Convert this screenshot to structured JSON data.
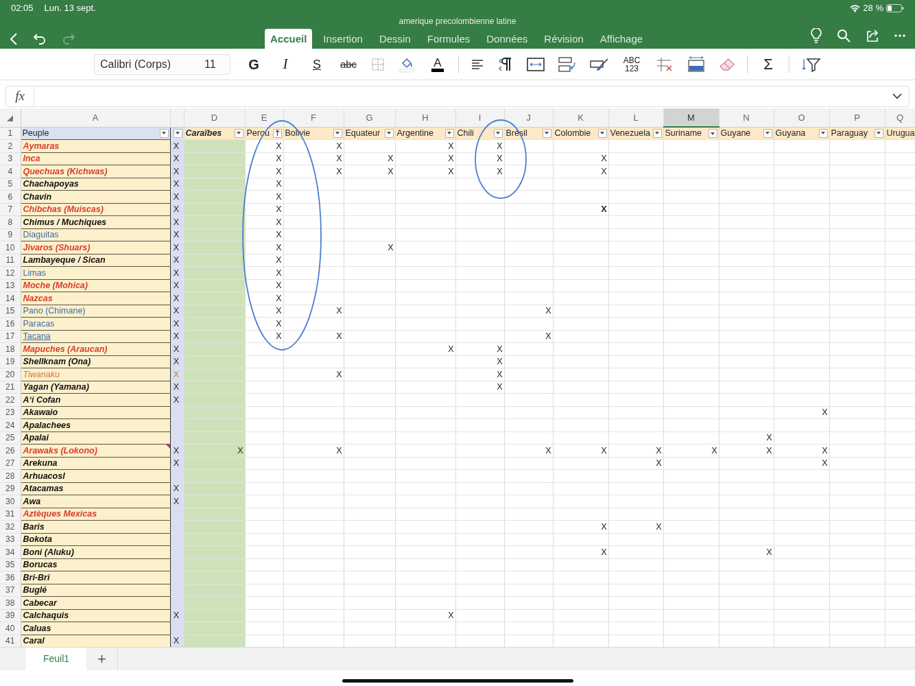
{
  "status_bar": {
    "time": "02:05",
    "date": "Lun. 13 sept.",
    "battery": "28 %"
  },
  "document_title": "amerique precolombienne latine",
  "nav": {
    "redo_disabled": true
  },
  "tabs": [
    {
      "label": "Accueil",
      "selected": true
    },
    {
      "label": "Insertion",
      "selected": false
    },
    {
      "label": "Dessin",
      "selected": false
    },
    {
      "label": "Formules",
      "selected": false
    },
    {
      "label": "Données",
      "selected": false
    },
    {
      "label": "Révision",
      "selected": false
    },
    {
      "label": "Affichage",
      "selected": false
    }
  ],
  "ribbon": {
    "font_name": "Calibri (Corps)",
    "font_size": "11",
    "groups": [
      [
        {
          "kind": "bold",
          "label": "G"
        },
        {
          "kind": "italic",
          "label": "I"
        },
        {
          "kind": "underline",
          "label": "S"
        },
        {
          "kind": "strikethrough",
          "label": "abc"
        },
        {
          "kind": "borders"
        },
        {
          "kind": "fill"
        },
        {
          "kind": "font-color",
          "label": "A"
        }
      ],
      [
        {
          "kind": "align"
        },
        {
          "kind": "paragraph"
        },
        {
          "kind": "wrap"
        },
        {
          "kind": "merge"
        },
        {
          "kind": "painter"
        },
        {
          "kind": "number-format",
          "label": "ABC",
          "sublabel": "123"
        },
        {
          "kind": "insert-delete"
        },
        {
          "kind": "cell-size"
        },
        {
          "kind": "clear"
        }
      ],
      [
        {
          "kind": "autosum",
          "label": "Σ"
        }
      ],
      [
        {
          "kind": "sort-filter"
        }
      ]
    ]
  },
  "formula_bar": {
    "label": "fx"
  },
  "sheet": {
    "columns": [
      {
        "letter": "A",
        "header": "Peuple",
        "kind": "plain",
        "filter": true,
        "sorted": false,
        "selected": false
      },
      {
        "kind": "plain",
        "filter": true,
        "sorted": false,
        "selected": false
      },
      {
        "letter": "D",
        "header": "Caraïbes",
        "kind": "emphasis",
        "filter": true,
        "sorted": false,
        "selected": false
      },
      {
        "letter": "E",
        "header": "Perou",
        "kind": "plain",
        "filter": true,
        "sorted": true,
        "selected": false
      },
      {
        "letter": "F",
        "header": "Bolivie",
        "kind": "plain",
        "filter": true,
        "sorted": false,
        "selected": false
      },
      {
        "letter": "G",
        "header": "Equateur",
        "kind": "plain",
        "filter": true,
        "sorted": false,
        "selected": false
      },
      {
        "letter": "H",
        "header": "Argentine",
        "kind": "plain",
        "filter": true,
        "sorted": false,
        "selected": false
      },
      {
        "letter": "I",
        "header": "Chili",
        "kind": "plain",
        "filter": true,
        "sorted": false,
        "selected": false
      },
      {
        "letter": "J",
        "header": "Brésil",
        "kind": "plain",
        "filter": true,
        "sorted": false,
        "selected": false
      },
      {
        "letter": "K",
        "header": "Colombie",
        "kind": "plain",
        "filter": true,
        "sorted": false,
        "selected": false
      },
      {
        "letter": "L",
        "header": "Venezuela",
        "kind": "plain",
        "filter": true,
        "sorted": false,
        "selected": false
      },
      {
        "letter": "M",
        "header": "Suriname",
        "kind": "plain",
        "filter": true,
        "sorted": false,
        "selected": true
      },
      {
        "letter": "N",
        "header": "Guyane",
        "kind": "plain",
        "filter": true,
        "sorted": false,
        "selected": false
      },
      {
        "letter": "O",
        "header": "Guyana",
        "kind": "plain",
        "filter": true,
        "sorted": false,
        "selected": false
      },
      {
        "letter": "P",
        "header": "Paraguay",
        "kind": "plain",
        "filter": true,
        "sorted": false,
        "selected": false
      },
      {
        "letter": "Q",
        "header": "Urugua",
        "kind": "plain",
        "selected": false
      }
    ],
    "header_row_number": "1",
    "rows": [
      {
        "number": "2",
        "kind": "red",
        "cells": [
          "Aymaras",
          "X",
          null,
          "X",
          "X",
          null,
          "X",
          "X",
          null,
          null,
          null,
          null,
          null,
          null,
          null,
          null
        ]
      },
      {
        "number": "3",
        "kind": "red",
        "cells": [
          "Inca",
          "X",
          null,
          "X",
          "X",
          "X",
          "X",
          "X",
          null,
          "X",
          null,
          null,
          null,
          null,
          null,
          null
        ]
      },
      {
        "number": "4",
        "kind": "red",
        "cells": [
          "Quechuas (Kichwas)",
          "X",
          null,
          "X",
          "X",
          "X",
          "X",
          "X",
          null,
          "X",
          null,
          null,
          null,
          null,
          null,
          null
        ]
      },
      {
        "number": "5",
        "kind": "black",
        "cells": [
          "Chachapoyas",
          "X",
          null,
          "X",
          null,
          null,
          null,
          null,
          null,
          null,
          null,
          null,
          null,
          null,
          null,
          null
        ]
      },
      {
        "number": "6",
        "kind": "black",
        "cells": [
          "Chavin",
          "X",
          null,
          "X",
          null,
          null,
          null,
          null,
          null,
          null,
          null,
          null,
          null,
          null,
          null,
          null
        ]
      },
      {
        "number": "7",
        "kind": "red",
        "cells": [
          "Chibchas (Muiscas)",
          "X",
          null,
          "X",
          null,
          null,
          null,
          null,
          null,
          "**X**",
          null,
          null,
          null,
          null,
          null,
          null
        ]
      },
      {
        "number": "8",
        "kind": "black",
        "cells": [
          "Chimus / Muchiques",
          "X",
          null,
          "X",
          null,
          null,
          null,
          null,
          null,
          null,
          null,
          null,
          null,
          null,
          null,
          null
        ]
      },
      {
        "number": "9",
        "kind": "blue",
        "cells": [
          "Diaguitas",
          "X",
          null,
          "X",
          null,
          null,
          null,
          null,
          null,
          null,
          null,
          null,
          null,
          null,
          null,
          null
        ]
      },
      {
        "number": "10",
        "kind": "red",
        "cells": [
          "Jivaros (Shuars)",
          "X",
          null,
          "X",
          null,
          "X",
          null,
          null,
          null,
          null,
          null,
          null,
          null,
          null,
          null,
          null
        ]
      },
      {
        "number": "11",
        "kind": "black",
        "cells": [
          "Lambayeque / Sican",
          "X",
          null,
          "X",
          null,
          null,
          null,
          null,
          null,
          null,
          null,
          null,
          null,
          null,
          null,
          null
        ]
      },
      {
        "number": "12",
        "kind": "blue",
        "cells": [
          "Limas",
          "X",
          null,
          "X",
          null,
          null,
          null,
          null,
          null,
          null,
          null,
          null,
          null,
          null,
          null,
          null
        ]
      },
      {
        "number": "13",
        "kind": "red",
        "cells": [
          "Moche (Mohica)",
          "X",
          null,
          "X",
          null,
          null,
          null,
          null,
          null,
          null,
          null,
          null,
          null,
          null,
          null,
          null
        ]
      },
      {
        "number": "14",
        "kind": "red",
        "cells": [
          "Nazcas",
          "X",
          null,
          "X",
          null,
          null,
          null,
          null,
          null,
          null,
          null,
          null,
          null,
          null,
          null,
          null
        ]
      },
      {
        "number": "15",
        "kind": "blue",
        "cells": [
          "Pano (Chimane)",
          "X",
          null,
          "X",
          "X",
          null,
          null,
          null,
          "X",
          null,
          null,
          null,
          null,
          null,
          null,
          null
        ]
      },
      {
        "number": "16",
        "kind": "blue",
        "cells": [
          "Paracas",
          "X",
          null,
          "X",
          null,
          null,
          null,
          null,
          null,
          null,
          null,
          null,
          null,
          null,
          null,
          null
        ]
      },
      {
        "number": "17",
        "kind": "link",
        "cells": [
          "Tacana",
          "X",
          null,
          "X",
          "X",
          null,
          null,
          null,
          "X",
          null,
          null,
          null,
          null,
          null,
          null,
          null
        ]
      },
      {
        "number": "18",
        "kind": "red",
        "cells": [
          "Mapuches (Araucan)",
          "X",
          null,
          null,
          null,
          null,
          "X",
          "X",
          null,
          null,
          null,
          null,
          null,
          null,
          null,
          null
        ]
      },
      {
        "number": "19",
        "kind": "black",
        "cells": [
          "Shellknam (Ona)",
          "X",
          null,
          null,
          null,
          null,
          null,
          "X",
          null,
          null,
          null,
          null,
          null,
          null,
          null,
          null
        ]
      },
      {
        "number": "20",
        "kind": "orange",
        "cells": [
          "Tiwanaku",
          "X",
          null,
          null,
          "X",
          null,
          null,
          "X",
          null,
          null,
          null,
          null,
          null,
          null,
          null,
          null
        ]
      },
      {
        "number": "21",
        "kind": "black",
        "cells": [
          "Yagan (Yamana)",
          "X",
          null,
          null,
          null,
          null,
          null,
          "X",
          null,
          null,
          null,
          null,
          null,
          null,
          null,
          null
        ]
      },
      {
        "number": "22",
        "kind": "black",
        "cells": [
          "A‘i Cofan",
          "X",
          null,
          null,
          null,
          null,
          null,
          null,
          null,
          null,
          null,
          null,
          null,
          null,
          null,
          null
        ]
      },
      {
        "number": "23",
        "kind": "black",
        "cells": [
          "Akawaio",
          null,
          null,
          null,
          null,
          null,
          null,
          null,
          null,
          null,
          null,
          null,
          null,
          "X",
          null,
          null
        ]
      },
      {
        "number": "24",
        "kind": "black",
        "cells": [
          "Apalachees",
          null,
          null,
          null,
          null,
          null,
          null,
          null,
          null,
          null,
          null,
          null,
          null,
          null,
          null,
          null
        ]
      },
      {
        "number": "25",
        "kind": "black",
        "cells": [
          "Apalai",
          null,
          null,
          null,
          null,
          null,
          null,
          null,
          null,
          null,
          null,
          null,
          "X",
          null,
          null,
          null
        ]
      },
      {
        "number": "26",
        "kind": "red",
        "comment": true,
        "cells": [
          "Arawaks (Lokono)",
          "X",
          "X",
          null,
          "X",
          null,
          null,
          null,
          "X",
          "X",
          "X",
          "X",
          "X",
          "X",
          null,
          null
        ]
      },
      {
        "number": "27",
        "kind": "black",
        "cells": [
          "Arekuna",
          "X",
          null,
          null,
          null,
          null,
          null,
          null,
          null,
          null,
          "X",
          null,
          null,
          "X",
          null,
          null
        ]
      },
      {
        "number": "28",
        "kind": "black",
        "cells": [
          "Arhuacosl",
          null,
          null,
          null,
          null,
          null,
          null,
          null,
          null,
          null,
          null,
          null,
          null,
          null,
          null,
          null
        ]
      },
      {
        "number": "29",
        "kind": "black",
        "cells": [
          "Atacamas",
          "X",
          null,
          null,
          null,
          null,
          null,
          null,
          null,
          null,
          null,
          null,
          null,
          null,
          null,
          null
        ]
      },
      {
        "number": "30",
        "kind": "black",
        "cells": [
          "Awa",
          "X",
          null,
          null,
          null,
          null,
          null,
          null,
          null,
          null,
          null,
          null,
          null,
          null,
          null,
          null
        ]
      },
      {
        "number": "31",
        "kind": "red",
        "cells": [
          "Aztèques Mexicas",
          null,
          null,
          null,
          null,
          null,
          null,
          null,
          null,
          null,
          null,
          null,
          null,
          null,
          null,
          null
        ]
      },
      {
        "number": "32",
        "kind": "black",
        "cells": [
          "Baris",
          null,
          null,
          null,
          null,
          null,
          null,
          null,
          null,
          "X",
          "X",
          null,
          null,
          null,
          null,
          null
        ]
      },
      {
        "number": "33",
        "kind": "black",
        "cells": [
          "Bokota",
          null,
          null,
          null,
          null,
          null,
          null,
          null,
          null,
          null,
          null,
          null,
          null,
          null,
          null,
          null
        ]
      },
      {
        "number": "34",
        "kind": "black",
        "cells": [
          "Boni (Aluku)",
          null,
          null,
          null,
          null,
          null,
          null,
          null,
          null,
          "X",
          null,
          null,
          "X",
          null,
          null,
          null
        ]
      },
      {
        "number": "35",
        "kind": "black",
        "cells": [
          "Borucas",
          null,
          null,
          null,
          null,
          null,
          null,
          null,
          null,
          null,
          null,
          null,
          null,
          null,
          null,
          null
        ]
      },
      {
        "number": "36",
        "kind": "black",
        "cells": [
          "Bri-Bri",
          null,
          null,
          null,
          null,
          null,
          null,
          null,
          null,
          null,
          null,
          null,
          null,
          null,
          null,
          null
        ]
      },
      {
        "number": "37",
        "kind": "black",
        "cells": [
          "Buglé",
          null,
          null,
          null,
          null,
          null,
          null,
          null,
          null,
          null,
          null,
          null,
          null,
          null,
          null,
          null
        ]
      },
      {
        "number": "38",
        "kind": "black",
        "cells": [
          "Cabecar",
          null,
          null,
          null,
          null,
          null,
          null,
          null,
          null,
          null,
          null,
          null,
          null,
          null,
          null,
          null
        ]
      },
      {
        "number": "39",
        "kind": "black",
        "cells": [
          "Calchaquis",
          "X",
          null,
          null,
          null,
          null,
          "X",
          null,
          null,
          null,
          null,
          null,
          null,
          null,
          null,
          null
        ]
      },
      {
        "number": "40",
        "kind": "black",
        "cells": [
          "Caluas",
          null,
          null,
          null,
          null,
          null,
          null,
          null,
          null,
          null,
          null,
          null,
          null,
          null,
          null,
          null
        ]
      },
      {
        "number": "41",
        "kind": "black",
        "cells": [
          "Caral",
          "X",
          null,
          null,
          null,
          null,
          null,
          null,
          null,
          null,
          null,
          null,
          null,
          null,
          null,
          null
        ]
      }
    ]
  },
  "sheet_tabs": [
    {
      "label": "Feuil1",
      "selected": true
    }
  ],
  "add_sheet": "+"
}
